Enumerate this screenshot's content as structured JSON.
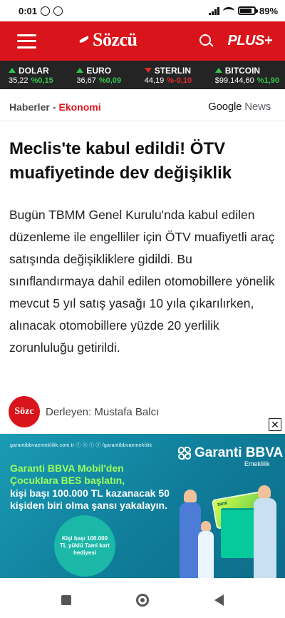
{
  "status_bar": {
    "time": "0:01",
    "battery": "89"
  },
  "header": {
    "logo": "Sözcü",
    "plus": "PLUS+"
  },
  "ticker": [
    {
      "name": "DOLAR",
      "value": "35,22",
      "change": "%0,15",
      "direction": "up"
    },
    {
      "name": "EURO",
      "value": "36,67",
      "change": "%0,09",
      "direction": "up"
    },
    {
      "name": "STERLIN",
      "value": "44,19",
      "change": "%-0,10",
      "direction": "down"
    },
    {
      "name": "BITCOIN",
      "value": "$99.144,60",
      "change": "%1,90",
      "direction": "up"
    }
  ],
  "breadcrumb": {
    "section": "Haberler",
    "separator": "-",
    "category": "Ekonomi"
  },
  "google_news": {
    "google": "Google",
    "news": "News"
  },
  "article": {
    "headline": "Meclis'te kabul edildi! ÖTV muafiyetinde dev değişiklik",
    "summary": "Bugün TBMM Genel Kurulu'nda kabul edilen düzenleme ile engelliler için ÖTV muafiyetli araç satışında değişikliklere gidildi. Bu sınıflandırmaya dahil edilen otomobillere yönelik mevcut 5 yıl satış yasağı 10 yıla çıkarılırken, alınacak otomobillere yüzde 20 yerlilik zorunluluğu getirildi.",
    "author_avatar": "Sözc",
    "author": "Derleyen: Mustafa Balcı"
  },
  "ad": {
    "close": "✕",
    "topline": "garantibbvaemeklilik.com.tr  ⓕ ⓧ ⓘ ⓨ  /garantibbvaemeklilik",
    "brand": "Garanti BBVA",
    "brand_sub": "Emeklilik",
    "line1": "Garanti BBVA Mobil'den Çocuklara BES başlatın,",
    "line2": "kişi başı 100.000 TL kazanacak 50 kişiden biri olma şansı yakalayın.",
    "circle": "Kişi başı 100.000 TL yüklü Tami kart hediyesi",
    "card_label": "tami"
  },
  "colors": {
    "brand_red": "#d9141b",
    "ticker_bg": "#242424",
    "up": "#31c64a",
    "down": "#e52a2a"
  }
}
